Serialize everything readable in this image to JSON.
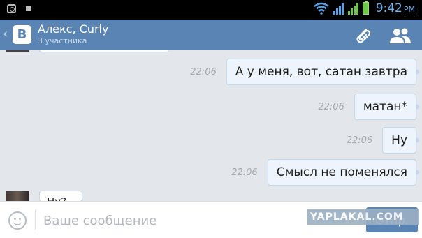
{
  "status_bar": {
    "time": "9:42",
    "time_suffix": "PM"
  },
  "header": {
    "logo_letter": "В",
    "title": "Алекс, Curly",
    "subtitle": "3 участника"
  },
  "messages": [
    {
      "time": "22:06",
      "text": "А у меня, вот, сатан завтра"
    },
    {
      "time": "22:06",
      "text": "матан*"
    },
    {
      "time": "22:06",
      "text": "Ну"
    },
    {
      "time": "22:06",
      "text": "Смысл не поменялся"
    }
  ],
  "incoming_peek": {
    "text": "Ну?"
  },
  "composer": {
    "placeholder": "Ваше сообщение",
    "send_label": "Отпр."
  },
  "watermark": "YAPLAKAL.COM",
  "colors": {
    "header_bg": "#5a84b4",
    "bubble_bg": "#eef4fb",
    "bubble_border": "#c2d7ec",
    "chat_bg": "#e3e6ea"
  },
  "icons": [
    "photo-icon",
    "notification-icon",
    "wifi-icon",
    "signal-icon",
    "battery-icon",
    "back-chevron-icon",
    "vk-logo",
    "paperclip-icon",
    "participants-icon",
    "smiley-icon"
  ]
}
